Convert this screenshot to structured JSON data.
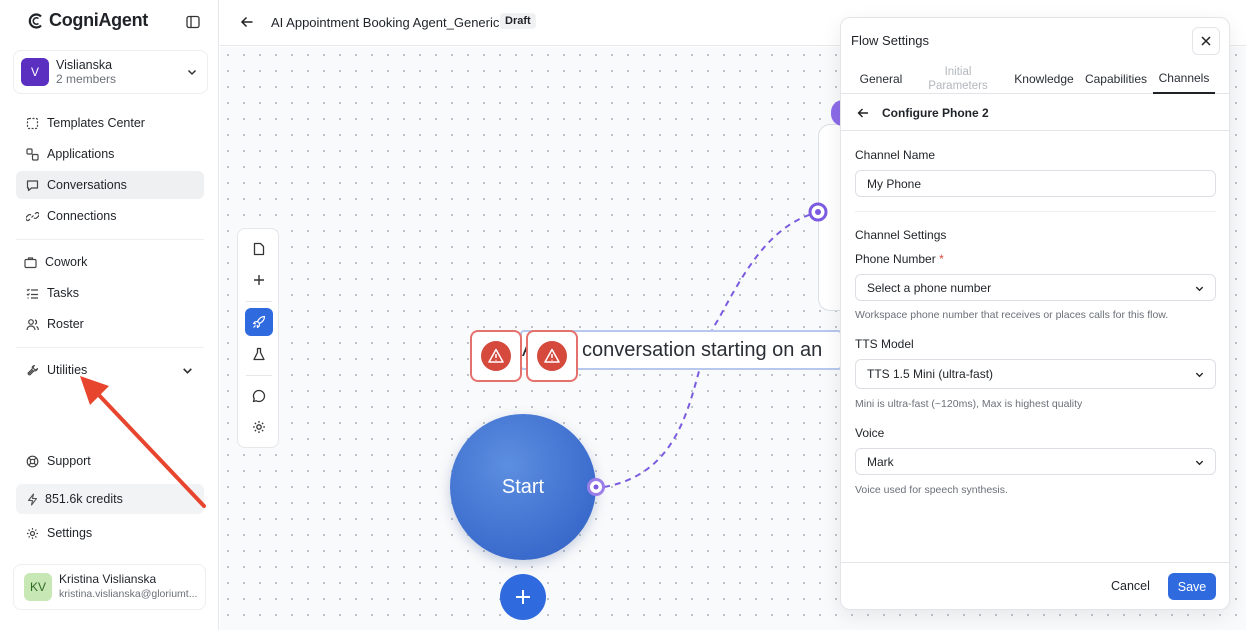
{
  "app": {
    "name": "CogniAgent"
  },
  "workspace": {
    "initial": "V",
    "name": "Vislianska",
    "members": "2 members"
  },
  "sidebar": {
    "items": [
      {
        "label": "Templates Center"
      },
      {
        "label": "Applications"
      },
      {
        "label": "Conversations"
      },
      {
        "label": "Connections"
      },
      {
        "label": "Cowork"
      },
      {
        "label": "Tasks"
      },
      {
        "label": "Roster"
      },
      {
        "label": "Utilities"
      },
      {
        "label": "Support"
      },
      {
        "label": "Settings"
      }
    ],
    "active": "Conversations"
  },
  "credits": {
    "label": "851.6k credits"
  },
  "user": {
    "initials": "KV",
    "name": "Kristina Vislianska",
    "email": "kristina.vislianska@gloriumt..."
  },
  "header": {
    "title": "AI Appointment Booking Agent_Generic",
    "status": "Draft"
  },
  "canvas": {
    "message_node": "A new conversation starting on an",
    "start_node": "Start"
  },
  "panel": {
    "title": "Flow Settings",
    "tabs": [
      {
        "label": "General",
        "state": "normal"
      },
      {
        "label": "Initial Parameters",
        "state": "disabled"
      },
      {
        "label": "Knowledge",
        "state": "normal"
      },
      {
        "label": "Capabilities",
        "state": "normal"
      },
      {
        "label": "Channels",
        "state": "active"
      }
    ],
    "sub_title": "Configure Phone 2",
    "channel_name": {
      "label": "Channel Name",
      "value": "My Phone"
    },
    "channel_settings": "Channel Settings",
    "phone_number": {
      "label": "Phone Number",
      "required": "*",
      "value": "Select a phone number",
      "hint": "Workspace phone number that receives or places calls for this flow."
    },
    "tts_model": {
      "label": "TTS Model",
      "value": "TTS 1.5 Mini (ultra-fast)",
      "hint": "Mini is ultra-fast (~120ms), Max is highest quality"
    },
    "voice": {
      "label": "Voice",
      "value": "Mark",
      "hint": "Voice used for speech synthesis."
    },
    "cancel": "Cancel",
    "save": "Save"
  },
  "colors": {
    "accent": "#2f6bdf",
    "workspace_avatar": "#5b2fc0",
    "warning": "#d64a3e",
    "edge": "#7b5be0",
    "annotation_arrow": "#e8452f"
  }
}
